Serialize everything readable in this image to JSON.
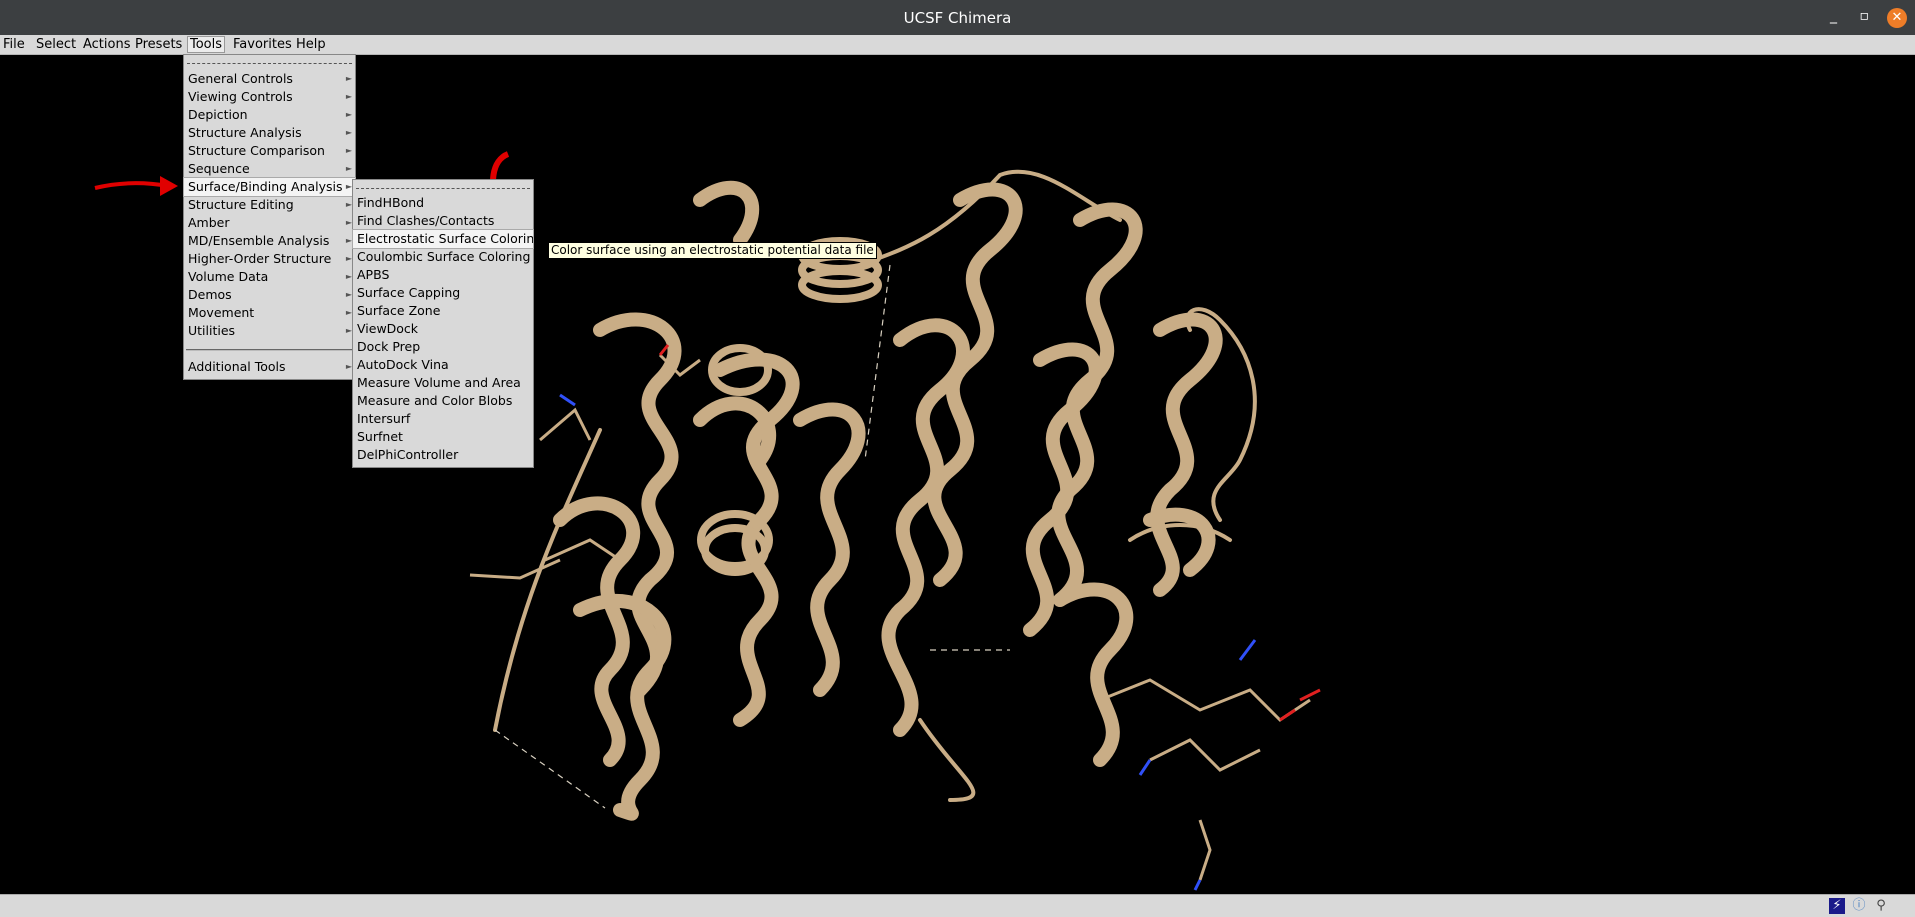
{
  "window": {
    "title": "UCSF Chimera",
    "minimize": "_",
    "maximize": "▫",
    "close": "✕"
  },
  "menubar": [
    "File",
    "Select",
    "Actions",
    "Presets",
    "Tools",
    "Favorites",
    "Help"
  ],
  "tools_menu": {
    "items": [
      {
        "label": "General Controls",
        "submenu": true
      },
      {
        "label": "Viewing Controls",
        "submenu": true
      },
      {
        "label": "Depiction",
        "submenu": true
      },
      {
        "label": "Structure Analysis",
        "submenu": true
      },
      {
        "label": "Structure Comparison",
        "submenu": true
      },
      {
        "label": "Sequence",
        "submenu": true
      },
      {
        "label": "Surface/Binding Analysis",
        "submenu": true,
        "active": true
      },
      {
        "label": "Structure Editing",
        "submenu": true
      },
      {
        "label": "Amber",
        "submenu": true
      },
      {
        "label": "MD/Ensemble Analysis",
        "submenu": true
      },
      {
        "label": "Higher-Order Structure",
        "submenu": true
      },
      {
        "label": "Volume Data",
        "submenu": true
      },
      {
        "label": "Demos",
        "submenu": true
      },
      {
        "label": "Movement",
        "submenu": true
      },
      {
        "label": "Utilities",
        "submenu": true
      }
    ],
    "extra": {
      "label": "Additional Tools",
      "submenu": true
    }
  },
  "surface_submenu": {
    "items": [
      "FindHBond",
      "Find Clashes/Contacts",
      "Electrostatic Surface Coloring",
      "Coulombic Surface Coloring",
      "APBS",
      "Surface Capping",
      "Surface Zone",
      "ViewDock",
      "Dock Prep",
      "AutoDock Vina",
      "Measure Volume and Area",
      "Measure and Color Blobs",
      "Intersurf",
      "Surfnet",
      "DelPhiController"
    ],
    "active_index": 2
  },
  "tooltip": "Color surface using an electrostatic potential data file",
  "colors": {
    "ribbon": "#d2b48c",
    "annotation": "#e00000",
    "background": "#000000",
    "nitrogen": "#3050f8",
    "oxygen": "#e02020"
  },
  "status_icons": [
    "lightning-icon",
    "info-icon",
    "magnifier-icon"
  ]
}
